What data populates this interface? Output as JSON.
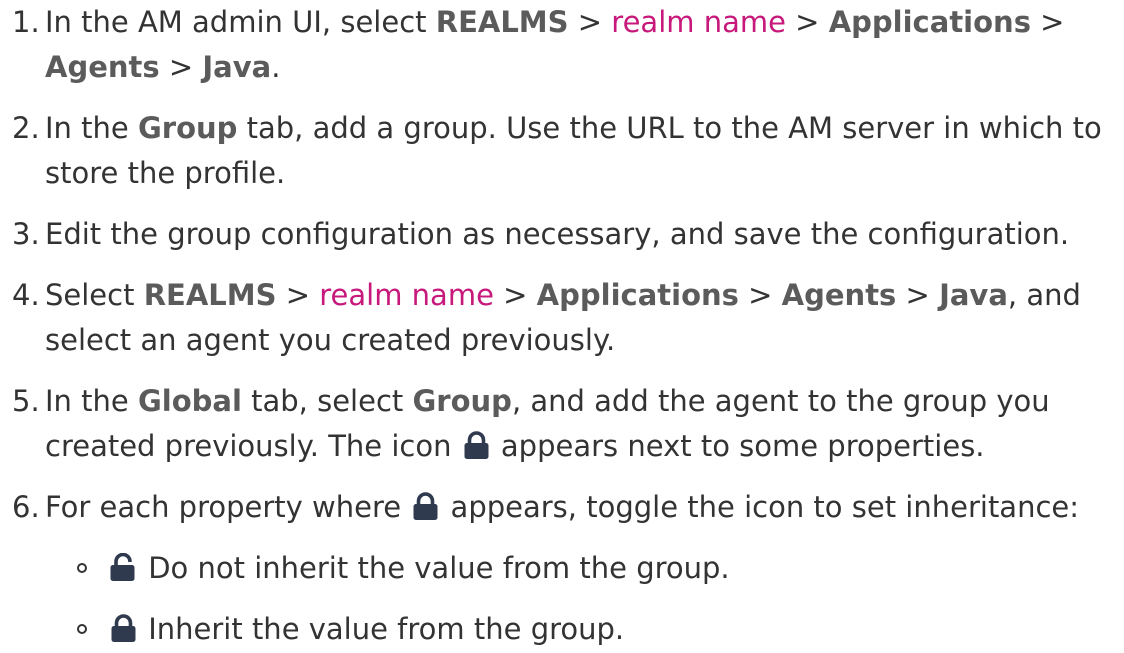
{
  "steps": [
    {
      "number": "1.",
      "parts": [
        {
          "text": "In the AM admin UI, select ",
          "style": "plain"
        },
        {
          "text": "REALMS",
          "style": "bold"
        },
        {
          "text": " > ",
          "style": "plain"
        },
        {
          "text": "realm name",
          "style": "var"
        },
        {
          "text": " > ",
          "style": "plain"
        },
        {
          "text": "Applications",
          "style": "bold"
        },
        {
          "text": " > ",
          "style": "plain"
        },
        {
          "text": "Agents",
          "style": "bold"
        },
        {
          "text": " > ",
          "style": "plain"
        },
        {
          "text": "Java",
          "style": "bold"
        },
        {
          "text": ".",
          "style": "plain"
        }
      ]
    },
    {
      "number": "2.",
      "parts": [
        {
          "text": "In the ",
          "style": "plain"
        },
        {
          "text": "Group",
          "style": "bold"
        },
        {
          "text": " tab, add a group. Use the URL to the AM server in which to store the profile.",
          "style": "plain"
        }
      ]
    },
    {
      "number": "3.",
      "parts": [
        {
          "text": "Edit the group configuration as necessary, and save the configuration.",
          "style": "plain"
        }
      ]
    },
    {
      "number": "4.",
      "parts": [
        {
          "text": "Select ",
          "style": "plain"
        },
        {
          "text": "REALMS",
          "style": "bold"
        },
        {
          "text": " > ",
          "style": "plain"
        },
        {
          "text": "realm name",
          "style": "var"
        },
        {
          "text": " > ",
          "style": "plain"
        },
        {
          "text": "Applications",
          "style": "bold"
        },
        {
          "text": " > ",
          "style": "plain"
        },
        {
          "text": "Agents",
          "style": "bold"
        },
        {
          "text": " > ",
          "style": "plain"
        },
        {
          "text": "Java",
          "style": "bold"
        },
        {
          "text": ", and select an agent you created previously.",
          "style": "plain"
        }
      ]
    },
    {
      "number": "5.",
      "parts": [
        {
          "text": "In the ",
          "style": "plain"
        },
        {
          "text": "Global",
          "style": "bold"
        },
        {
          "text": " tab, select ",
          "style": "plain"
        },
        {
          "text": "Group",
          "style": "bold"
        },
        {
          "text": ", and add the agent to the group you created previously. The icon ",
          "style": "plain"
        },
        {
          "icon": "lock-icon"
        },
        {
          "text": " appears next to some properties.",
          "style": "plain"
        }
      ]
    },
    {
      "number": "6.",
      "parts": [
        {
          "text": "For each property where ",
          "style": "plain"
        },
        {
          "icon": "lock-icon"
        },
        {
          "text": " appears, toggle the icon to set inheritance:",
          "style": "plain"
        }
      ],
      "subitems": [
        {
          "icon": "unlock-icon",
          "text": " Do not inherit the value from the group."
        },
        {
          "icon": "lock-icon",
          "text": " Inherit the value from the group."
        }
      ]
    }
  ],
  "colors": {
    "text": "#333333",
    "bold": "#5b5b5b",
    "variable": "#c7187b",
    "icon": "#2f3a4f"
  }
}
